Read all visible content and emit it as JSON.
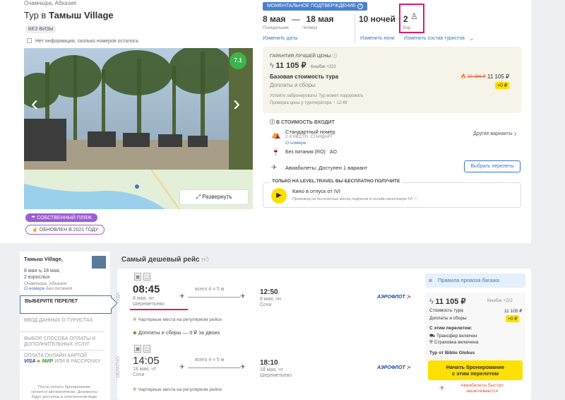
{
  "hotel": {
    "location": "Очамчыра, Абхазия",
    "title_prefix": "Тур в",
    "title_name": "Тамыш Village",
    "visa_badge": "БЕЗ ВИЗЫ",
    "rooms_info": "Нет информации, сколько номеров осталось",
    "rating": "7.1",
    "map_button": "Развернуть",
    "beach_badge": "СОБСТВЕННЫЙ ПЛЯЖ",
    "renovated_badge": "ОБНОВЛЕН В 2021 ГОДУ"
  },
  "booking": {
    "instant_badge": "МОМЕНТАЛЬНОЕ ПОДТВЕРЖДЕНИЕ",
    "date_from": "8 мая",
    "dash": "—",
    "date_to": "18 мая",
    "day_from": "Понедельник",
    "day_to": "Четверг",
    "change_dates": "Изменить даты",
    "nights": "10 ночей",
    "change_nights": "Изменить ночи",
    "tourists_count": "2",
    "tourists_label": "Взр.",
    "change_tourists": "Изменить состав туристов"
  },
  "price_box": {
    "guarantee": "ГАРАНТИЯ ЛУЧШЕЙ ЦЕНЫ",
    "price": "11 105 ₽",
    "cashback": "Кешбэк +222",
    "base_label": "Базовая стоимость тура",
    "fees_label": "Доплаты и сборы",
    "old_price": "20 266 ₽",
    "base_value": "11 105 ₽",
    "fees_value": "+0 ₽",
    "note1": "Успейте забронировать! Тур может подорожать",
    "note2": "Проверка цены у туроператора",
    "note2_time": "12:49"
  },
  "includes": {
    "title": "В СТОИМОСТЬ ВХОДИТ",
    "room_name": "Стандартный номер",
    "room_type": "2-Х МЕСТН. СТАНДАРТ",
    "room_link": "О номере",
    "other_variants": "Другие варианты",
    "meal": "Без питания (RO)",
    "meal_code": "AO",
    "flights": "Авиабилеты. Доступен 1 вариант",
    "choose_flights": "Выбрать перелеты"
  },
  "free_box": {
    "title": "ТОЛЬКО НА LEVEL.TRAVEL ВЫ БЕСПЛАТНО ПОЛУЧИТЕ",
    "item": "Кино в отпуск от IVI",
    "desc": "Промокод на бесплатные месяц подписки в онлайн-кинотеатре IVI"
  },
  "sidebar": {
    "hotel": "Тамыш Village,",
    "dates_from": "8 мая",
    "dates_to": "18 мая,",
    "adults": "2 взрослых",
    "location": "Очамчыра, Абхазия",
    "room_link": "О номере",
    "meal": "Без питания",
    "steps": [
      "ВЫБЕРИТЕ ПЕРЕЛЕТ",
      "ВВОД ДАННЫХ О ТУРИСТАХ",
      "ВЫБОР СПОСОБА ОПЛАТЫ И ДОПОЛНИТЕЛЬНЫХ УСЛУГ",
      "ОПЛАТА ОНЛАЙН КАРТОЙ",
      "ИЛИ В РАССРОЧКУ"
    ],
    "footer1": "После оплаты бронирование",
    "footer2": "начнется автоматически. Документы",
    "footer3": "будут доступны в электронном виде"
  },
  "flights": {
    "section_title": "Самый дешевый рейс",
    "outbound_label": "ТУДА",
    "return_label": "ОБРАТНО",
    "out_dep_time": "08:45",
    "out_dep_date": "8 мая, пн",
    "out_dep_airport": "Шереметьево",
    "out_duration": "всего 4 ч 5 м",
    "out_arr_time": "12:50",
    "out_arr_date": "8 мая, пн",
    "out_arr_city": "Сочи",
    "airline": "АЭРОФЛОТ",
    "charter_note": "Чартерные места на регулярном рейсе",
    "fees_line": "Доплаты и сборы — 0 ₽ за двоих",
    "ret_dep_time": "14:05",
    "ret_dep_date": "18 мая, чт",
    "ret_dep_city": "Сочи",
    "ret_duration": "всего 4 ч 5 м",
    "ret_arr_time": "18:10",
    "ret_arr_date": "18 мая, чт",
    "ret_arr_airport": "Шереметьево"
  },
  "summary": {
    "baggage": "Правила провоза багажа",
    "price": "11 105 ₽",
    "cashback": "Кешбэк +222",
    "cost_label": "Стоимость тура",
    "cost_value": "11 105 ₽",
    "fees_label": "Доплаты и сборы",
    "fees_value": "+0 ₽",
    "with_flight": "С этим перелетом:",
    "transfer": "Трансфер включен",
    "insurance": "Страховка включена",
    "operator": "Тур от Biblio Globus",
    "book_btn_1": "Начать бронирование",
    "book_btn_2": "с этим перелетом",
    "sold_1": "Авиабилеты быстро",
    "sold_2": "заканчиваются"
  },
  "colors": {
    "accent_blue": "#3a78c4",
    "yellow": "#ffe000",
    "purple_badge": "#9b5fd6",
    "highlight_pink": "#e0186c",
    "green_rating": "#3bb54a"
  }
}
